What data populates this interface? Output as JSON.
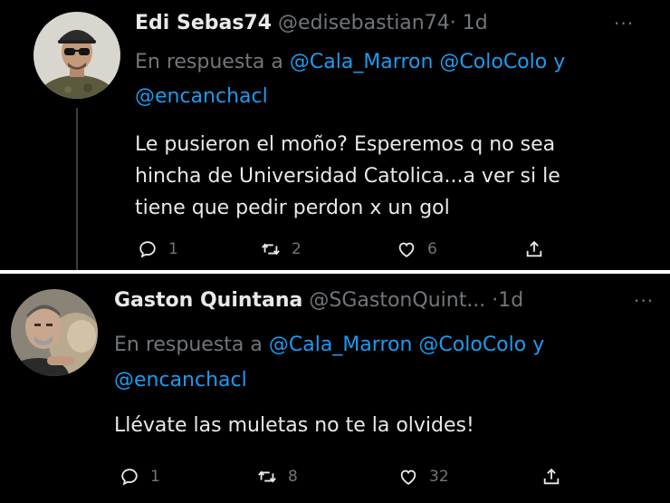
{
  "tweets": [
    {
      "name": "Edi Sebas74",
      "handle": "@edisebastian74",
      "separator": "·",
      "time": "1d",
      "more_label": "···",
      "reply_prefix": "En respuesta a",
      "mentions": [
        "@Cala_Marron",
        "@ColoColo",
        "@encanchacl"
      ],
      "mentions_joiner": "y",
      "text_lines": [
        "Le pusieron el moño? Esperemos q no sea",
        "hincha de Universidad Catolica...a ver si le",
        "tiene que pedir perdon x un gol"
      ],
      "actions": {
        "reply": {
          "icon": "reply-icon",
          "count": "1"
        },
        "retweet": {
          "icon": "retweet-icon",
          "count": "2"
        },
        "like": {
          "icon": "heart-icon",
          "count": "6"
        },
        "share": {
          "icon": "share-icon"
        }
      }
    },
    {
      "name": "Gaston Quintana",
      "handle": "@SGastonQuint...",
      "separator": "·",
      "time": "1d",
      "more_label": "···",
      "reply_prefix": "En respuesta a",
      "mentions": [
        "@Cala_Marron",
        "@ColoColo",
        "@encanchacl"
      ],
      "mentions_joiner": "y",
      "text_lines": [
        "Llévate las muletas no te la olvides!"
      ],
      "actions": {
        "reply": {
          "icon": "reply-icon",
          "count": "1"
        },
        "retweet": {
          "icon": "retweet-icon",
          "count": "8"
        },
        "like": {
          "icon": "heart-icon",
          "count": "32"
        },
        "share": {
          "icon": "share-icon"
        }
      }
    }
  ],
  "colors": {
    "background": "#000000",
    "text": "#e7e9ea",
    "muted": "#71767b",
    "mention": "#1d9bf0",
    "separator": "#ffffff"
  }
}
